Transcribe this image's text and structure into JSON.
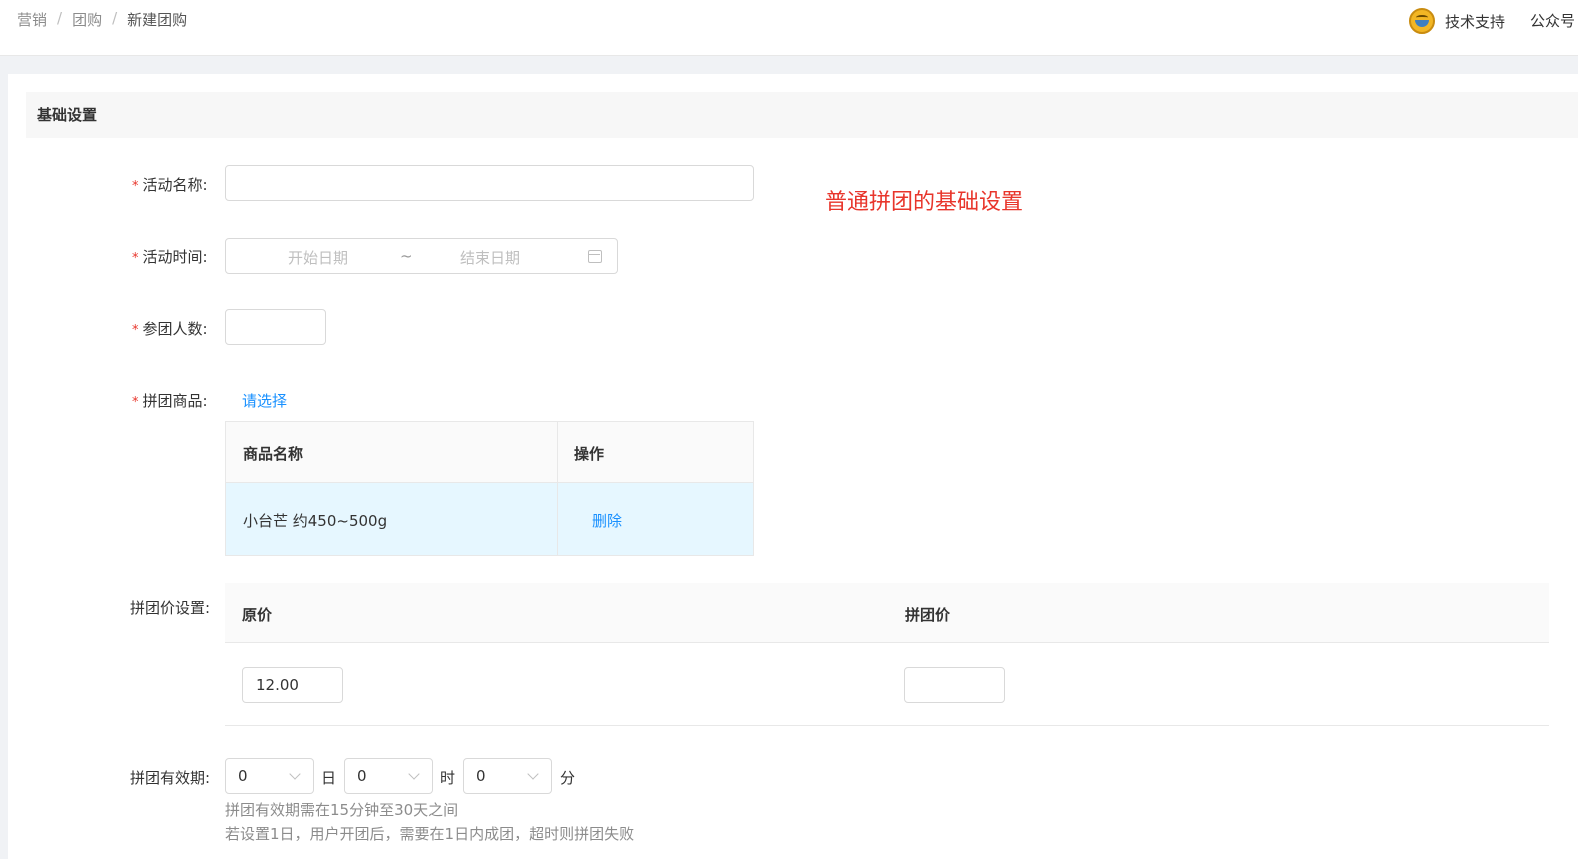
{
  "breadcrumb": {
    "items": [
      "营销",
      "团购",
      "新建团购"
    ],
    "separator": "/"
  },
  "header": {
    "support_label": "技术支持",
    "gzh_label": "公众号"
  },
  "section": {
    "title": "基础设置",
    "note": "普通拼团的基础设置"
  },
  "form": {
    "activity_name": {
      "label": "活动名称:",
      "value": ""
    },
    "activity_time": {
      "label": "活动时间:",
      "start_placeholder": "开始日期",
      "range_sep": "~",
      "end_placeholder": "结束日期"
    },
    "group_size": {
      "label": "参团人数:",
      "value": ""
    },
    "group_goods": {
      "label": "拼团商品:",
      "select_link": "请选择",
      "columns": [
        "商品名称",
        "操作"
      ],
      "rows": [
        {
          "name": "小台芒 约450~500g",
          "action": "删除"
        }
      ]
    },
    "price_settings": {
      "label": "拼团价设置:",
      "columns": [
        "原价",
        "拼团价"
      ],
      "original_price": "12.00",
      "group_price": ""
    },
    "validity": {
      "label": "拼团有效期:",
      "day_value": "0",
      "day_unit": "日",
      "hour_value": "0",
      "hour_unit": "时",
      "minute_value": "0",
      "minute_unit": "分",
      "hint_1": "拼团有效期需在15分钟至30天之间",
      "hint_2": "若设置1日，用户开团后，需要在1日内成团，超时则拼团失败"
    }
  },
  "colors": {
    "required": "#e8352b",
    "link": "#1890ff",
    "selected_row": "#e6f7ff"
  }
}
